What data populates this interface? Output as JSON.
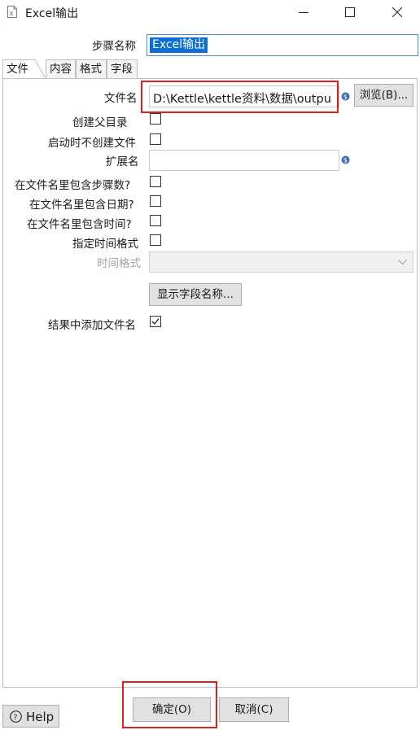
{
  "window": {
    "title": "Excel输出"
  },
  "step": {
    "label": "步骤名称",
    "value": "Excel输出"
  },
  "tabs": [
    {
      "label": "文件"
    },
    {
      "label": "内容"
    },
    {
      "label": "格式"
    },
    {
      "label": "字段"
    }
  ],
  "file": {
    "filename_label": "文件名",
    "filename_value": "D:\\Kettle\\kettle资料\\数据\\outpu",
    "browse_label": "浏览(B)...",
    "create_parent_label": "创建父目录",
    "no_create_on_start_label": "启动时不创建文件",
    "extension_label": "扩展名",
    "extension_value": "",
    "include_stepnr_label": "在文件名里包含步骤数?",
    "include_date_label": "在文件名里包含日期?",
    "include_time_label": "在文件名里包含时间?",
    "specify_format_label": "指定时间格式",
    "time_format_label": "时间格式",
    "time_format_value": "",
    "show_fields_label": "显示字段名称...",
    "add_to_result_label": "结果中添加文件名"
  },
  "footer": {
    "help_label": "Help",
    "ok_label": "确定(O)",
    "cancel_label": "取消(C)"
  },
  "colors": {
    "highlight_box": "#e0201b",
    "selection": "#0a6ed4",
    "variable_icon": "#3f6fa8"
  }
}
